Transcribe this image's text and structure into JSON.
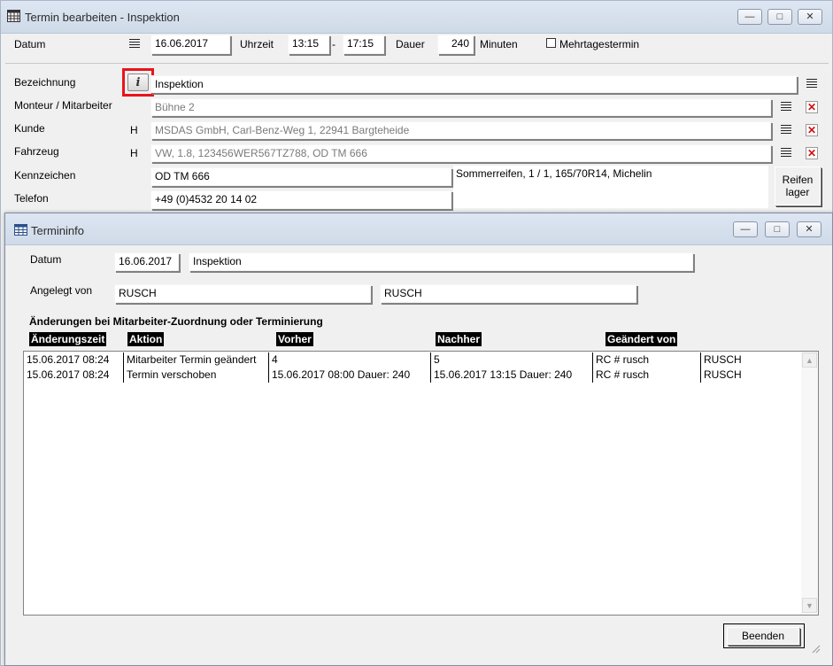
{
  "main_window": {
    "title": "Termin bearbeiten - Inspektion",
    "controls": {
      "minimize": "—",
      "maximize": "□",
      "close": "✕"
    },
    "datum": {
      "label": "Datum",
      "value": "16.06.2017"
    },
    "uhrzeit": {
      "label": "Uhrzeit",
      "from": "13:15",
      "separator": "-",
      "to": "17:15"
    },
    "dauer": {
      "label": "Dauer",
      "value": "240",
      "unit": "Minuten"
    },
    "mehrtagestermin": {
      "label": "Mehrtagestermin",
      "checked": false
    },
    "bezeichnung": {
      "label": "Bezeichnung",
      "info_button": "i",
      "value": "Inspektion"
    },
    "monteur": {
      "label": "Monteur / Mitarbeiter",
      "value": "Bühne 2"
    },
    "kunde": {
      "label": "Kunde",
      "marker": "H",
      "value": "MSDAS GmbH, Carl-Benz-Weg 1, 22941 Bargteheide"
    },
    "fahrzeug": {
      "label": "Fahrzeug",
      "marker": "H",
      "value": "VW, 1.8, 123456WER567TZ788, OD TM 666"
    },
    "kennzeichen": {
      "label": "Kennzeichen",
      "value": "OD TM 666"
    },
    "telefon": {
      "label": "Telefon",
      "value": "+49 (0)4532 20 14 02"
    },
    "reifen_info": "Sommerreifen, 1 / 1, 165/70R14, Michelin",
    "reifen_button": {
      "line1": "Reifen",
      "line2": "lager"
    },
    "highlight_color": "#e8141c"
  },
  "child_window": {
    "title": "Termininfo",
    "controls": {
      "minimize": "—",
      "maximize": "□",
      "close": "✕"
    },
    "datum": {
      "label": "Datum",
      "value": "16.06.2017",
      "bezeichnung": "Inspektion"
    },
    "angelegt_von": {
      "label": "Angelegt von",
      "value1": "RUSCH",
      "value2": "RUSCH"
    },
    "section_title": "Änderungen bei Mitarbeiter-Zuordnung oder Terminierung",
    "columns": [
      "Änderungszeit",
      "Aktion",
      "Vorher",
      "Nachher",
      "Geändert von"
    ],
    "rows": [
      [
        "15.06.2017 08:24",
        "Mitarbeiter Termin geändert",
        "4",
        "5",
        "RC # rusch",
        "RUSCH"
      ],
      [
        "15.06.2017 08:24",
        "Termin verschoben",
        "15.06.2017 08:00 Dauer: 240",
        "15.06.2017 13:15 Dauer: 240",
        "RC # rusch",
        "RUSCH"
      ]
    ],
    "scroll_up": "▲",
    "scroll_down": "▼",
    "close_button": "Beenden"
  }
}
